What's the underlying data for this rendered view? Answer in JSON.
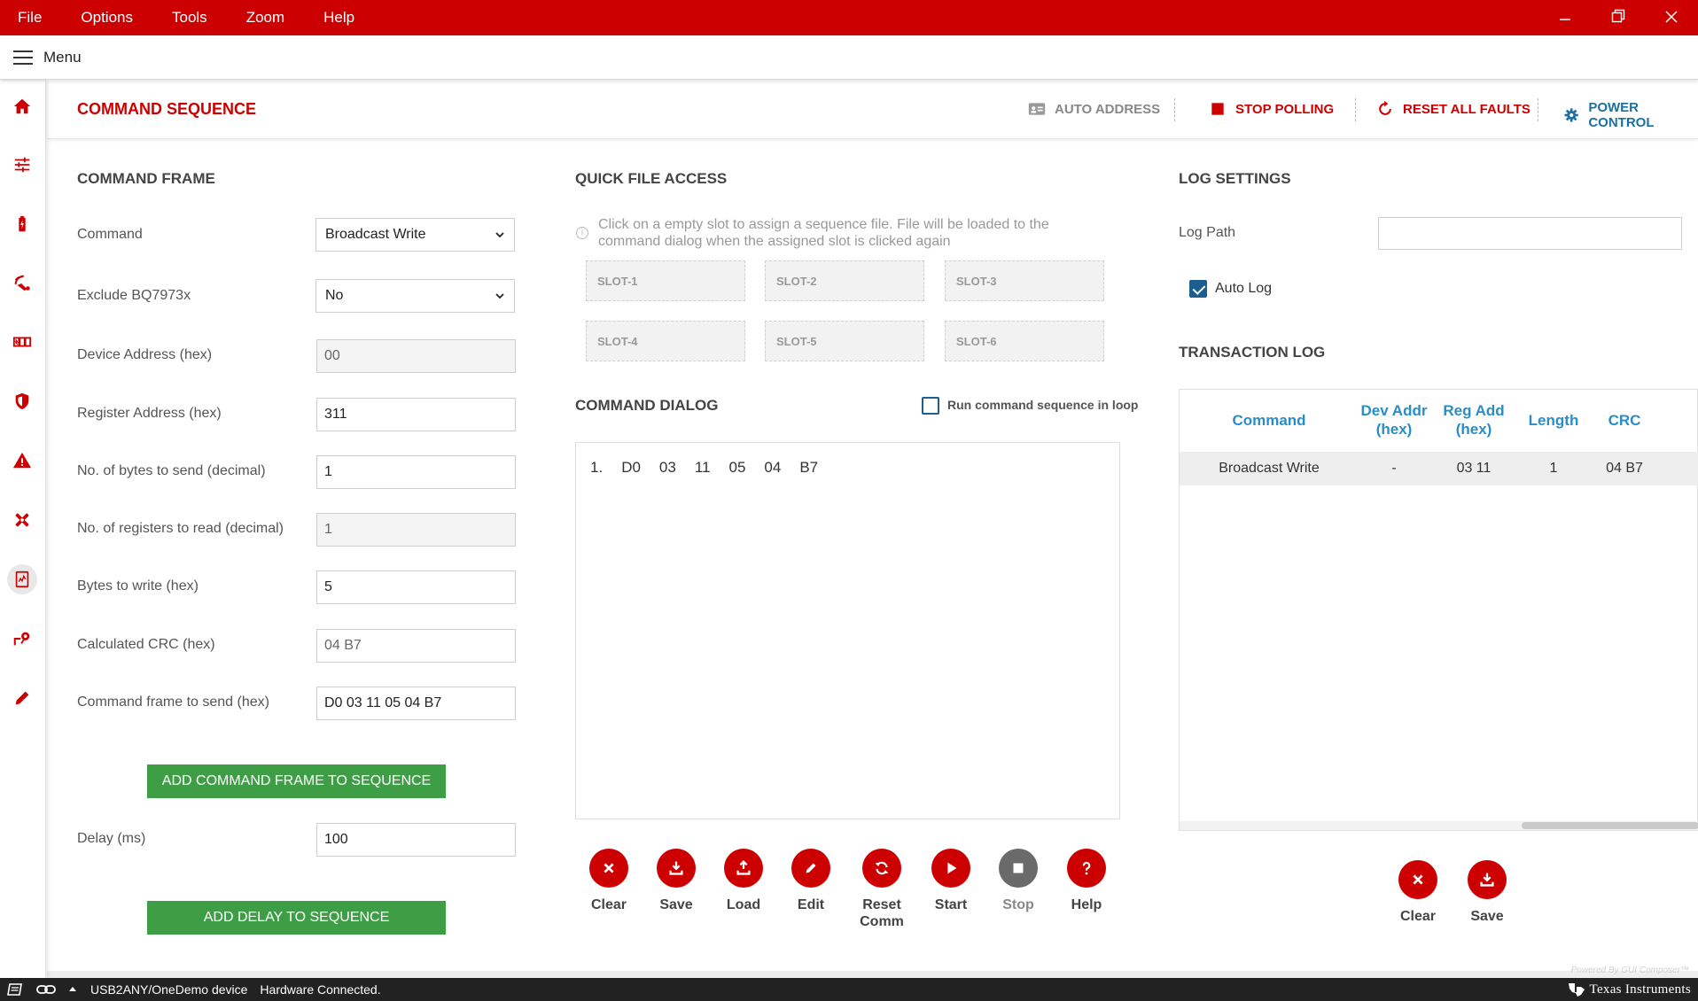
{
  "menubar": {
    "items": [
      "File",
      "Options",
      "Tools",
      "Zoom",
      "Help"
    ]
  },
  "topbar": {
    "menu_label": "Menu"
  },
  "header": {
    "title": "COMMAND SEQUENCE",
    "auto_address": "AUTO ADDRESS",
    "stop_polling": "STOP POLLING",
    "reset_all_faults": "RESET ALL FAULTS",
    "power_control": "POWER CONTROL"
  },
  "command_frame": {
    "title": "COMMAND FRAME",
    "command_label": "Command",
    "command_value": "Broadcast Write",
    "exclude_label": "Exclude BQ7973x",
    "exclude_value": "No",
    "device_address_label": "Device Address (hex)",
    "device_address_value": "00",
    "register_address_label": "Register Address (hex)",
    "register_address_value": "311",
    "bytes_to_send_label": "No. of bytes to send (decimal)",
    "bytes_to_send_value": "1",
    "registers_to_read_label": "No. of registers to read (decimal)",
    "registers_to_read_value": "1",
    "bytes_to_write_label": "Bytes to write (hex)",
    "bytes_to_write_value": "5",
    "crc_label": "Calculated CRC (hex)",
    "crc_value": "04 B7",
    "frame_label": "Command frame to send (hex)",
    "frame_value": "D0 03 11 05 04 B7",
    "add_frame_button": "ADD COMMAND FRAME TO SEQUENCE",
    "delay_label": "Delay (ms)",
    "delay_value": "100",
    "add_delay_button": "ADD DELAY TO SEQUENCE"
  },
  "quick_file": {
    "title": "QUICK FILE ACCESS",
    "hint": "Click on a empty slot to assign a sequence file. File will be loaded to the command dialog when the assigned slot is clicked again",
    "slots": [
      "SLOT-1",
      "SLOT-2",
      "SLOT-3",
      "SLOT-4",
      "SLOT-5",
      "SLOT-6"
    ]
  },
  "command_dialog": {
    "title": "COMMAND DIALOG",
    "loop_label": "Run command sequence in loop",
    "loop_checked": false,
    "line_number": "1.",
    "bytes": [
      "D0",
      "03",
      "11",
      "05",
      "04",
      "B7"
    ],
    "buttons": [
      "Clear",
      "Save",
      "Load",
      "Edit",
      "Reset Comm",
      "Start",
      "Stop",
      "Help"
    ]
  },
  "log_settings": {
    "title": "LOG SETTINGS",
    "path_label": "Log Path",
    "path_value": "",
    "auto_log_label": "Auto Log",
    "auto_log_checked": true
  },
  "transaction_log": {
    "title": "TRANSACTION LOG",
    "columns": [
      "Command",
      "Dev Addr (hex)",
      "Reg Add (hex)",
      "Length",
      "CRC"
    ],
    "rows": [
      [
        "Broadcast Write",
        "-",
        "03 11",
        "1",
        "04 B7"
      ]
    ],
    "buttons": [
      "Clear",
      "Save"
    ]
  },
  "statusbar": {
    "device": "USB2ANY/OneDemo device",
    "status": "Hardware Connected.",
    "brand": "Texas Instruments"
  },
  "footer": {
    "powered": "Powered By GUI Composer™"
  },
  "colors": {
    "accent": "#cc0000",
    "green": "#3e9e46",
    "blue": "#2a8ec6"
  }
}
